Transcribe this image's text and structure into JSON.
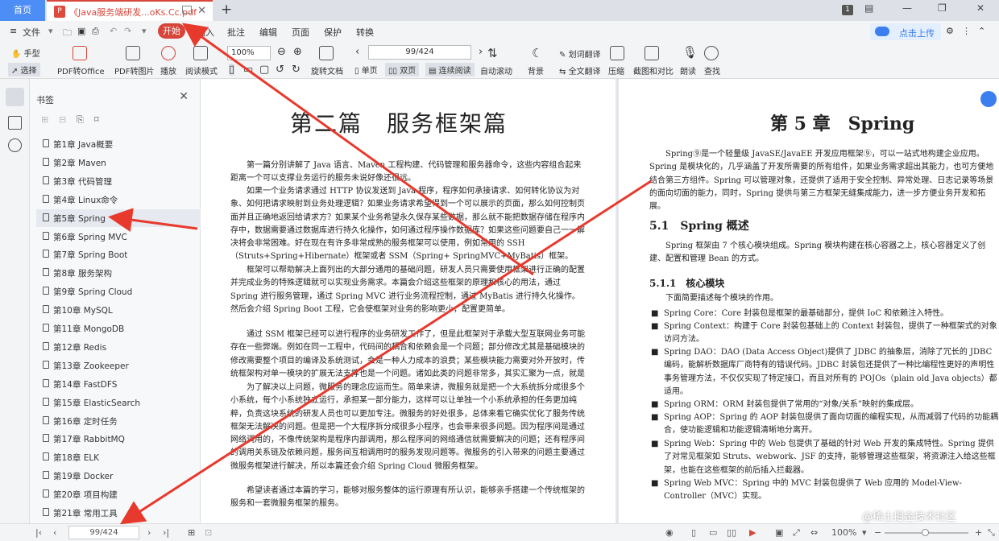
{
  "tabs": {
    "home": "首页",
    "doc": "《Java服务端研发...oKs.Cc.pdf",
    "badge": "1"
  },
  "menu": {
    "items": [
      "文件",
      "开始",
      "插入",
      "批注",
      "编辑",
      "页面",
      "保护",
      "转换"
    ],
    "cloud": "点击上传"
  },
  "ribbon": {
    "hand": "手型",
    "select": "选择",
    "pdf2office": "PDF转Office",
    "pdf2img": "PDF转图片",
    "play": "播放",
    "readmode": "阅读模式",
    "zoom": "100%",
    "rotate": "旋转文档",
    "page_value": "99/424",
    "single": "单页",
    "double": "双页",
    "continuous": "连续阅读",
    "autoscroll": "自动滚动",
    "background": "背景",
    "wordtrans": "划词翻译",
    "fulltrans": "全文翻译",
    "compress": "压缩",
    "compare": "截图和对比",
    "read": "朗读",
    "find": "查找"
  },
  "bookmarks": {
    "title": "书签",
    "items": [
      "第1章 Java概要",
      "第2章 Maven",
      "第3章 代码管理",
      "第4章 Linux命令",
      "第5章 Spring",
      "第6章 Spring MVC",
      "第7章 Spring Boot",
      "第8章 服务架构",
      "第9章 Spring Cloud",
      "第10章 MySQL",
      "第11章 MongoDB",
      "第12章 Redis",
      "第13章 Zookeeper",
      "第14章 FastDFS",
      "第15章 ElasticSearch",
      "第16章 定时任务",
      "第17章 RabbitMQ",
      "第18章 ELK",
      "第19章 Docker",
      "第20章 项目构建",
      "第21章 常用工具"
    ],
    "selected": 4
  },
  "page_left": {
    "title": "第二篇　服务框架篇",
    "paragraphs": [
      "　　第一篇分别讲解了 Java 语言、Maven 工程构建、代码管理和服务器命令，这些内容组合起来距离一个可以支撑业务运行的服务未说好像还很远。",
      "　　如果一个业务请求通过 HTTP 协议发送到 Java 程序，程序如何承接请求、如何转化协议为对象、如何把请求映射到业务处理逻辑？如果业务请求希望得到一个可以展示的页面，那么如何控制页面并且正确地返回给请求方？如果某个业务希望永久保存某些数据，那么就不能把数据存储在程序内存中，数据需要通过数据库进行持久化操作，如何通过程序操作数据库？如果这些问题要自己一一解决将会非常困难。好在现在有许多非常成熟的服务框架可以使用，例如常用的 SSH（Struts+Spring+Hibernate）框架或者 SSM（Spring+ SpringMVC+MyBatis）框架。",
      "　　框架可以帮助解决上面列出的大部分通用的基础问题，研发人员只需要使用框架进行正确的配置并完成业务的特殊逻辑就可以实现业务需求。本篇会介绍这些框架的原理和核心的用法，通过 Spring 进行服务管理，通过 Spring MVC 进行业务流程控制，通过 MyBatis 进行持久化操作。然后会介绍 Spring Boot 工程，它会使框架对业务的影响更小，配置更简单。",
      "　　通过 SSM 框架已经可以进行程序的业务研发工作了，但是此框架对于承载大型互联网业务可能存在一些弊端。例如在同一工程中，代码间的耦合和依赖会是一个问题；部分修改尤其是基础模块的修改需要整个项目的编译及系统测试，会是一种人力成本的浪费；某些模块能力需要对外开放时，传统框架构对单一模块的扩展无法支撑也是一个问题。诸如此类的问题非常多，其实汇聚为一点，就是大系统不灵活。",
      "　　为了解决以上问题，微服务的理念应运而生。简单来讲，微服务就是把一个大系统拆分成很多个小系统，每个小系统独立运行，承担某一部分能力，这样可以让单独一个小系统承担的任务更加纯粹，负责这块系统的研发人员也可以更加专注。微服务的好处很多，总体来看它确实优化了服务传统框架无法解决的问题。但是把一个大程序拆分成很多小程序，也会带来很多问题。因为程序间是通过网络调用的，不像传统架构是程序内部调用，那么程序间的网络通信就需要解决的问题；还有程序间的调用关系链及依赖问题，服务间互相调用时的服务发现问题等。微服务的引入带来的问题主要通过微服务框架进行解决，所以本篇还会介绍 Spring Cloud 微服务框架。",
      "　　希望读者通过本篇的学习，能够对服务整体的运行原理有所认识，能够亲手搭建一个传统框架的服务和一套微服务框架的服务。"
    ]
  },
  "page_right": {
    "title": "第 5 章　Spring",
    "intro": "　　Spring⑨是一个轻量级 JavaSE/JavaEE 开发应用框架⑨，可以一站式地构建企业应用。Spring 是模块化的，几乎涵盖了开发所需要的所有组件，如果业务需求超出其能力，也可方便地结合第三方组件。Spring 可以管理对象，还提供了适用于安全控制、异常处理、日志记录等场景的面向切面的能力，同时，Spring 提供与第三方框架无缝集成能力，进一步方便业务开发和拓展。",
    "h1": "5.1　Spring 概述",
    "p1": "　　Spring 框架由 7 个核心模块组成。Spring 模块构建在核心容器之上，核心容器定义了创建、配置和管理 Bean 的方式。",
    "h2": "5.1.1　核心模块",
    "p2": "　　下面简要描述每个模块的作用。",
    "bullets": [
      "Spring Core：Core 封装包是框架的最基础部分，提供 IoC 和依赖注入特性。",
      "Spring Context：构建于 Core 封装包基础上的 Context 封装包，提供了一种框架式的对象访问方法。",
      "Spring DAO：DAO (Data Access Object)提供了 JDBC 的抽象层，消除了冗长的 JDBC 编码，能解析数据库厂商特有的错误代码。JDBC 封装包还提供了一种比编程性更好的声明性事务管理方法，不仅仅实现了特定接口，而且对所有的 POJOs（plain old Java objects）都适用。",
      "Spring ORM：ORM 封装包提供了常用的“对象/关系”映射的集成层。",
      "Spring AOP：Spring 的 AOP 封装包提供了面向切面的编程实现，从而减弱了代码的功能耦合，使功能逻辑和功能逻辑清晰地分离开。",
      "Spring Web：Spring 中的 Web 包提供了基础的针对 Web 开发的集成特性。Spring 提供了对常见框架如 Struts、webwork、JSF 的支持，能够管理这些框架，将资源注入给这些框架，也能在这些框架的前后插入拦截器。",
      "Spring Web MVC：Spring 中的 MVC 封装包提供了 Web 应用的 Model-View-Controller（MVC）实现。"
    ]
  },
  "status": {
    "page_value": "99/424",
    "zoom": "100%"
  },
  "watermark": "@稀土掘金技术社区",
  "colors": {
    "accent": "#d6453a",
    "home_tab": "#4d8df6",
    "arrow": "#e8392d"
  }
}
